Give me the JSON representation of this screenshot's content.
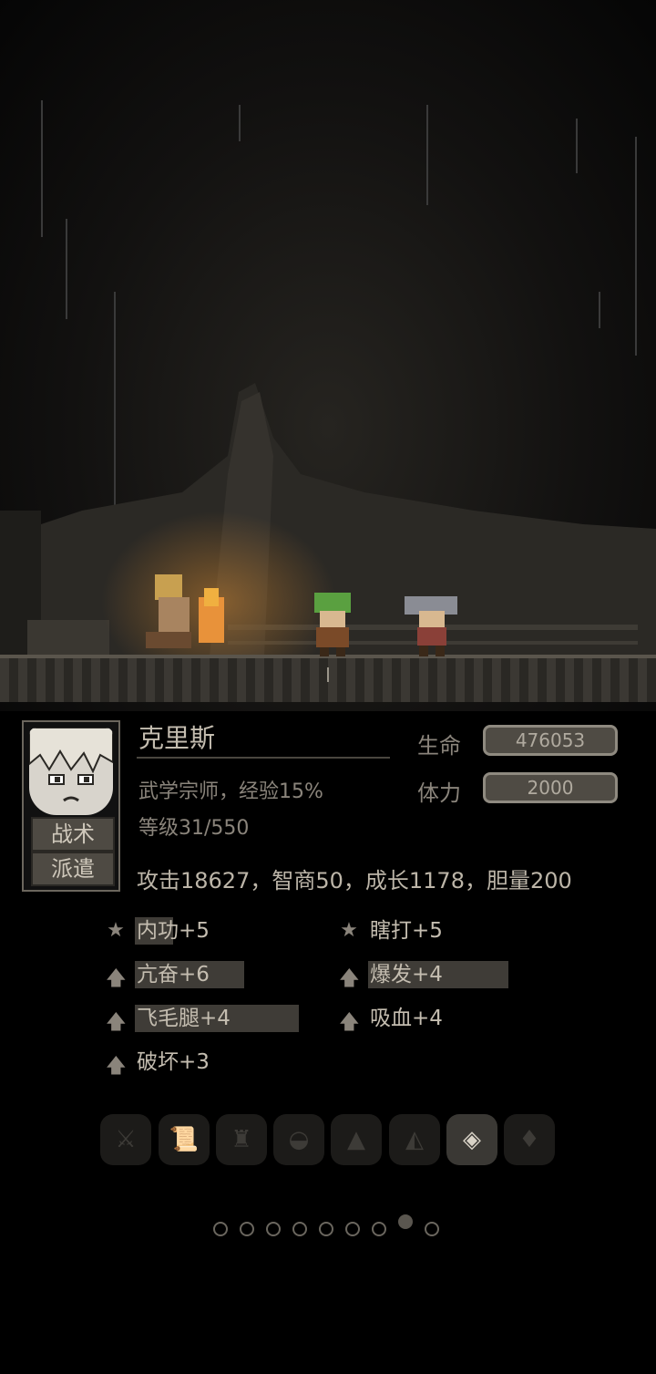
{
  "character": {
    "name": "克里斯",
    "title_exp": "武学宗师，经验15%",
    "level": "等级31/550",
    "hp_label": "生命",
    "hp_value": "476053",
    "stamina_label": "体力",
    "stamina_value": "2000",
    "attributes": "攻击18627，智商50，成长1178，胆量200"
  },
  "buttons": {
    "tactics": "战术",
    "dispatch": "派遣"
  },
  "skills": [
    {
      "icon": "star-icon",
      "label": "内功+5"
    },
    {
      "icon": "star-icon",
      "label": "瞎打+5"
    },
    {
      "icon": "arrow-up-icon",
      "label": "亢奋+6"
    },
    {
      "icon": "arrow-up-icon",
      "label": "爆发+4"
    },
    {
      "icon": "arrow-up-icon",
      "label": "飞毛腿+4"
    },
    {
      "icon": "arrow-up-icon",
      "label": "吸血+4"
    },
    {
      "icon": "arrow-up-icon",
      "label": "破坏+3"
    }
  ],
  "equipment_slots": [
    {
      "icon": "sword-icon",
      "active": false
    },
    {
      "icon": "scroll-icon",
      "active": false
    },
    {
      "icon": "armor-icon",
      "active": false
    },
    {
      "icon": "boots-icon",
      "active": false
    },
    {
      "icon": "cloak-icon",
      "active": false
    },
    {
      "icon": "helmet-icon",
      "active": false
    },
    {
      "icon": "drop-icon",
      "active": true
    },
    {
      "icon": "gem-icon",
      "active": false
    }
  ],
  "pagination": {
    "total": 9,
    "current": 8
  },
  "colors": {
    "background": "#000000",
    "panel_text": "#a8a29a",
    "fire": "#e8923a"
  }
}
